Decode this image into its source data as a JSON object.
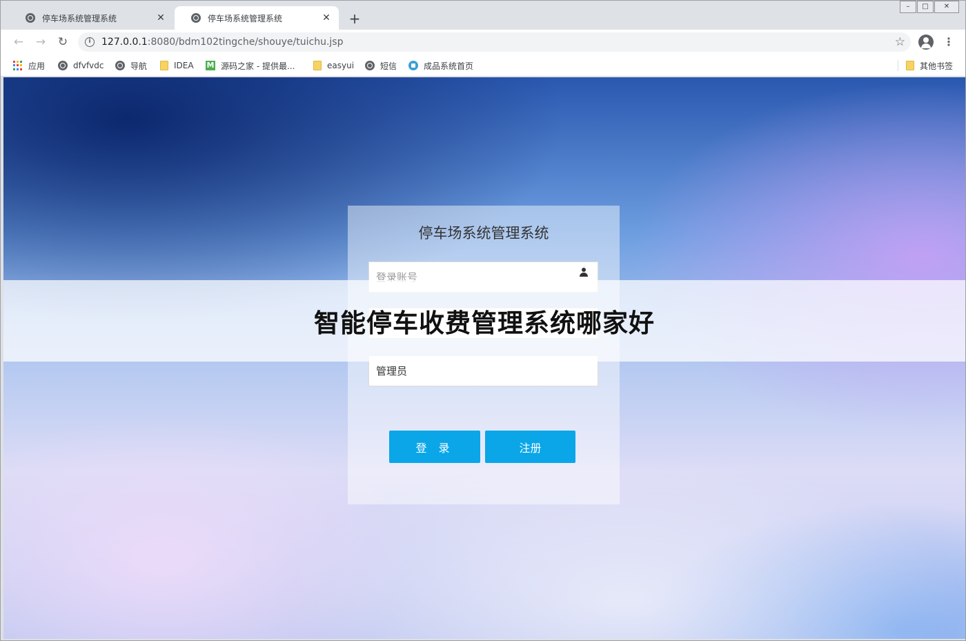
{
  "browser": {
    "tabs": [
      {
        "title": "停车场系统管理系统",
        "active": false
      },
      {
        "title": "停车场系统管理系统",
        "active": true
      }
    ],
    "new_tab": "+",
    "close_glyph": "✕",
    "url_host": "127.0.0.1",
    "url_rest": ":8080/bdm102tingche/shouye/tuichu.jsp",
    "bookmarks": [
      {
        "label": "应用",
        "icon": "apps-grid-icon"
      },
      {
        "label": "dfvfvdc",
        "icon": "globe-icon"
      },
      {
        "label": "导航",
        "icon": "globe-icon"
      },
      {
        "label": "IDEA",
        "icon": "folder-icon"
      },
      {
        "label": "源码之家 - 提供最...",
        "icon": "m-logo-icon"
      },
      {
        "label": "easyui",
        "icon": "folder-icon"
      },
      {
        "label": "短信",
        "icon": "globe-icon"
      },
      {
        "label": "成品系统首页",
        "icon": "home-icon"
      }
    ],
    "other_bookmarks": "其他书签"
  },
  "login": {
    "title": "停车场系统管理系统",
    "username_placeholder": "登录账号",
    "password_placeholder": "",
    "role_value": "管理员",
    "login_button": "登 录",
    "register_button": "注册"
  },
  "overlay": {
    "text": "智能停车收费管理系统哪家好"
  },
  "colors": {
    "button": "#0aa6e8",
    "tab_bg": "#dee1e6"
  }
}
